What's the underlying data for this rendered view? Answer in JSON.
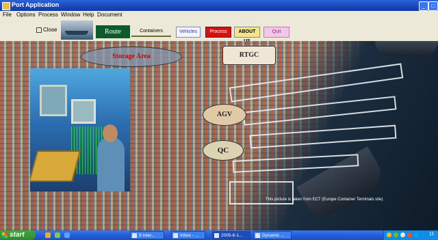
{
  "window": {
    "title": "Port Application",
    "colors": {
      "titlebar": "#1a47b8",
      "route_tab": "#0d5a2a",
      "process_button": "#d51212"
    }
  },
  "menu": [
    "File",
    "Options",
    "Process",
    "Window",
    "Help",
    "Document"
  ],
  "toolbar": {
    "close_label": "Close",
    "tabs": {
      "route": "Route",
      "containers": "Containers"
    },
    "buttons": {
      "vehicles": "Vehicles",
      "process": "Process",
      "about": "ABOUT US",
      "quit": "Quit"
    }
  },
  "map": {
    "labels": {
      "storage_area": "Storage Area",
      "rtgc": "RTGC",
      "agv": "AGV",
      "qc": "QC"
    },
    "caption": "This picture is taken from ECT (Europe Container Terminals site)"
  },
  "taskbar": {
    "start": "start",
    "tasks": [
      "9 Inter...",
      "Inbox - ...",
      "2005-6-1...",
      "Dynamic ..."
    ],
    "clock": "11"
  }
}
